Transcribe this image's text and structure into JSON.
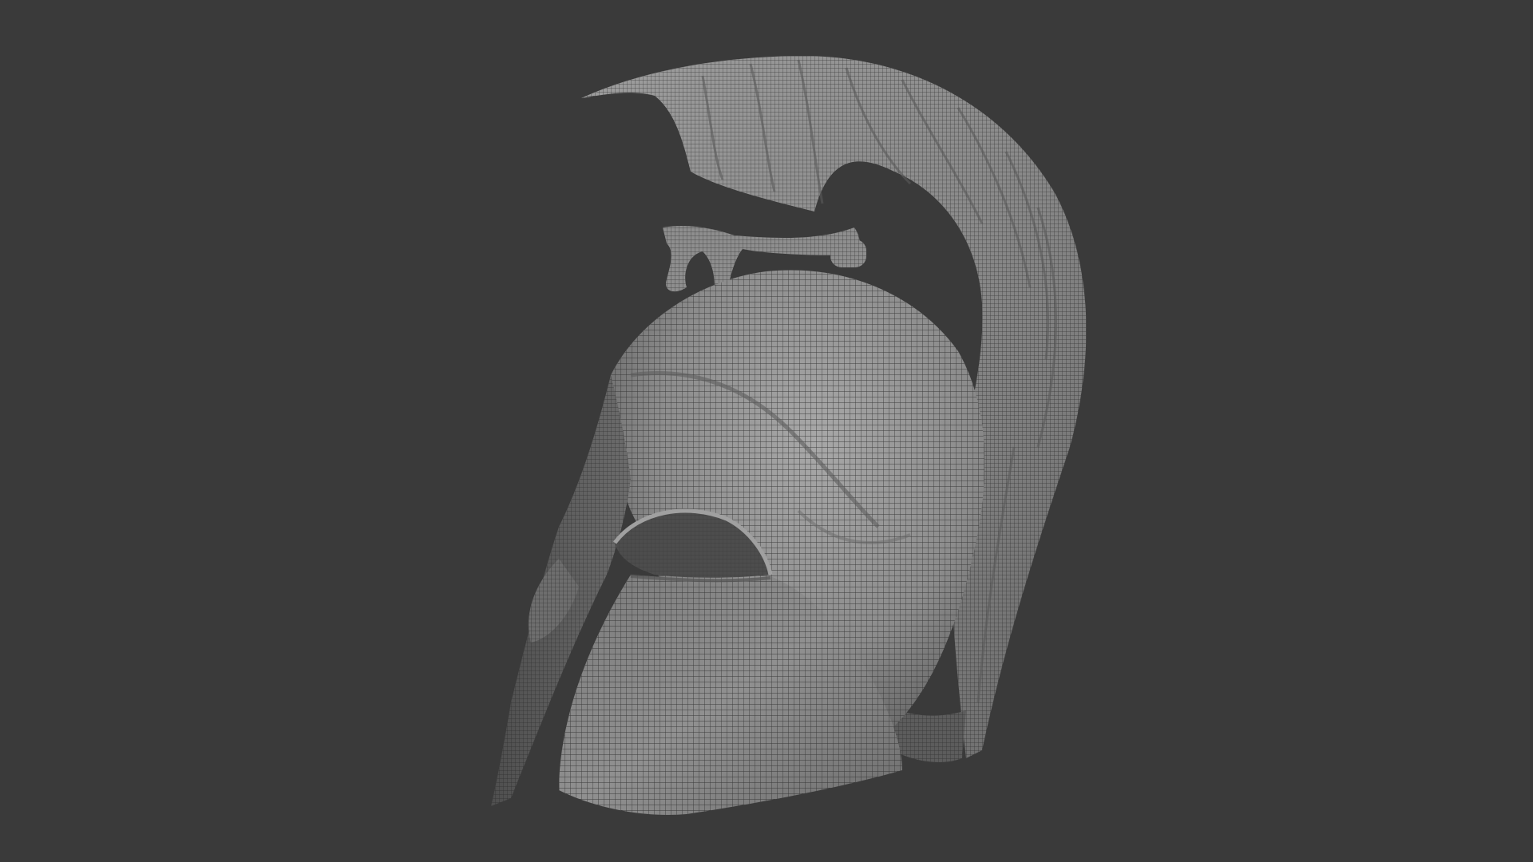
{
  "viewport": {
    "background_color": "#3a3a3a",
    "model": {
      "name": "corinthian-helmet-wireframe",
      "shading": "grey-matcap-with-wireframe",
      "base_color": "#8a8a8a",
      "wire_color": "#2a2a2a"
    }
  }
}
